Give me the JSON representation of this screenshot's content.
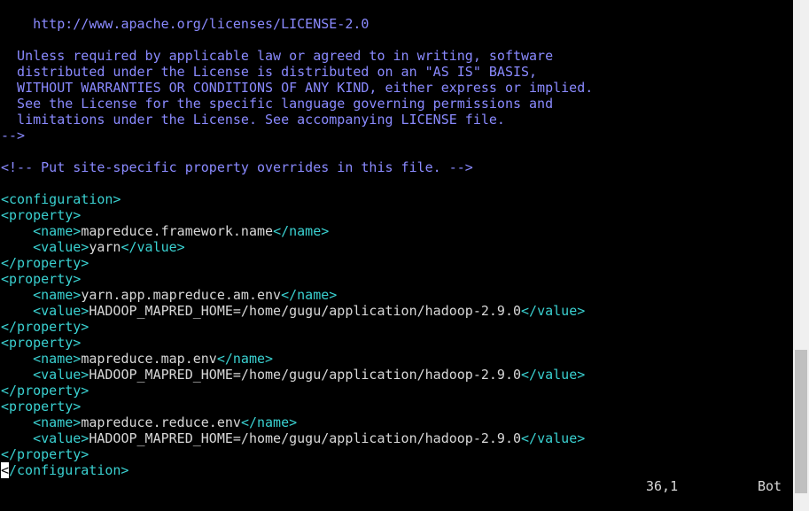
{
  "colors": {
    "background": "#000000",
    "comment": "#8a8aff",
    "tag": "#3ad1d1",
    "text": "#d8d8d8",
    "scrollbar_track": "#f0f0f0",
    "scrollbar_thumb": "#c0c0c0"
  },
  "editor": {
    "lines": [
      [
        {
          "t": "c",
          "v": "    http://www.apache.org/licenses/LICENSE-2.0"
        }
      ],
      [],
      [
        {
          "t": "c",
          "v": "  Unless required by applicable law or agreed to in writing, software"
        }
      ],
      [
        {
          "t": "c",
          "v": "  distributed under the License is distributed on an \"AS IS\" BASIS,"
        }
      ],
      [
        {
          "t": "c",
          "v": "  WITHOUT WARRANTIES OR CONDITIONS OF ANY KIND, either express or implied."
        }
      ],
      [
        {
          "t": "c",
          "v": "  See the License for the specific language governing permissions and"
        }
      ],
      [
        {
          "t": "c",
          "v": "  limitations under the License. See accompanying LICENSE file."
        }
      ],
      [
        {
          "t": "c",
          "v": "-->"
        }
      ],
      [],
      [
        {
          "t": "c",
          "v": "<!-- Put site-specific property overrides in this file. -->"
        }
      ],
      [],
      [
        {
          "t": "g",
          "v": "<configuration>"
        }
      ],
      [
        {
          "t": "g",
          "v": "<property>"
        }
      ],
      [
        {
          "t": "s",
          "v": "    "
        },
        {
          "t": "g",
          "v": "<name>"
        },
        {
          "t": "x",
          "v": "mapreduce.framework.name"
        },
        {
          "t": "g",
          "v": "</name>"
        }
      ],
      [
        {
          "t": "s",
          "v": "    "
        },
        {
          "t": "g",
          "v": "<value>"
        },
        {
          "t": "x",
          "v": "yarn"
        },
        {
          "t": "g",
          "v": "</value>"
        }
      ],
      [
        {
          "t": "g",
          "v": "</property>"
        }
      ],
      [
        {
          "t": "g",
          "v": "<property>"
        }
      ],
      [
        {
          "t": "s",
          "v": "    "
        },
        {
          "t": "g",
          "v": "<name>"
        },
        {
          "t": "x",
          "v": "yarn.app.mapreduce.am.env"
        },
        {
          "t": "g",
          "v": "</name>"
        }
      ],
      [
        {
          "t": "s",
          "v": "    "
        },
        {
          "t": "g",
          "v": "<value>"
        },
        {
          "t": "x",
          "v": "HADOOP_MAPRED_HOME=/home/gugu/application/hadoop-2.9.0"
        },
        {
          "t": "g",
          "v": "</value>"
        }
      ],
      [
        {
          "t": "g",
          "v": "</property>"
        }
      ],
      [
        {
          "t": "g",
          "v": "<property>"
        }
      ],
      [
        {
          "t": "s",
          "v": "    "
        },
        {
          "t": "g",
          "v": "<name>"
        },
        {
          "t": "x",
          "v": "mapreduce.map.env"
        },
        {
          "t": "g",
          "v": "</name>"
        }
      ],
      [
        {
          "t": "s",
          "v": "    "
        },
        {
          "t": "g",
          "v": "<value>"
        },
        {
          "t": "x",
          "v": "HADOOP_MAPRED_HOME=/home/gugu/application/hadoop-2.9.0"
        },
        {
          "t": "g",
          "v": "</value>"
        }
      ],
      [
        {
          "t": "g",
          "v": "</property>"
        }
      ],
      [
        {
          "t": "g",
          "v": "<property>"
        }
      ],
      [
        {
          "t": "s",
          "v": "    "
        },
        {
          "t": "g",
          "v": "<name>"
        },
        {
          "t": "x",
          "v": "mapreduce.reduce.env"
        },
        {
          "t": "g",
          "v": "</name>"
        }
      ],
      [
        {
          "t": "s",
          "v": "    "
        },
        {
          "t": "g",
          "v": "<value>"
        },
        {
          "t": "x",
          "v": "HADOOP_MAPRED_HOME=/home/gugu/application/hadoop-2.9.0"
        },
        {
          "t": "g",
          "v": "</value>"
        }
      ],
      [
        {
          "t": "g",
          "v": "</property>"
        }
      ],
      [
        {
          "t": "k",
          "v": "<"
        },
        {
          "t": "g",
          "v": "/configuration>"
        }
      ]
    ]
  },
  "status": {
    "position": "36,1",
    "scroll_percent": "Bot"
  },
  "scrollbar": {
    "thumb_start_fraction": 0.685,
    "thumb_end_fraction": 0.965
  }
}
